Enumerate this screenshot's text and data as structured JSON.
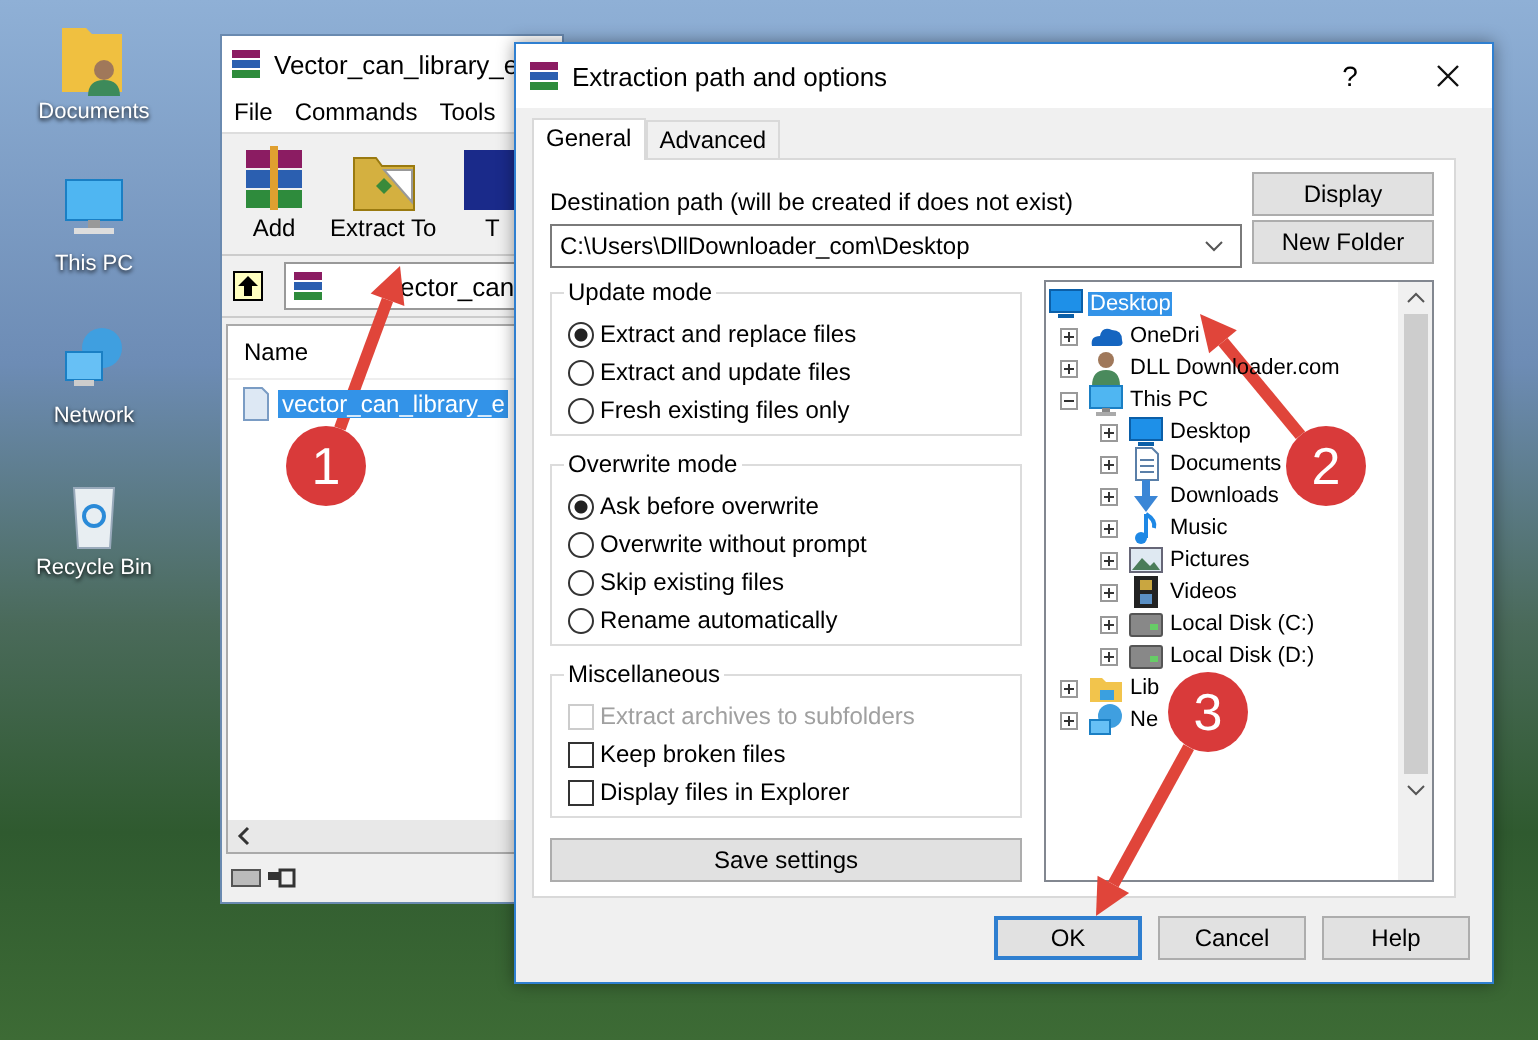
{
  "desktop_icons": [
    {
      "label": "Documents",
      "kind": "documents"
    },
    {
      "label": "This PC",
      "kind": "pc"
    },
    {
      "label": "Network",
      "kind": "network"
    },
    {
      "label": "Recycle Bin",
      "kind": "recycle"
    }
  ],
  "archive_window": {
    "title": "Vector_can_library_e",
    "menu": [
      "File",
      "Commands",
      "Tools"
    ],
    "toolbar": [
      {
        "label": "Add",
        "kind": "add"
      },
      {
        "label": "Extract To",
        "kind": "extract"
      },
      {
        "label": "T",
        "kind": "test"
      }
    ],
    "address": "ector_can",
    "list_header": "Name",
    "files": [
      {
        "name": "vector_can_library_e",
        "selected": true
      }
    ]
  },
  "dialog": {
    "title": "Extraction path and options",
    "help": "?",
    "tabs": [
      {
        "label": "General",
        "selected": true
      },
      {
        "label": "Advanced",
        "selected": false
      }
    ],
    "destination_label": "Destination path (will be created if does not exist)",
    "destination_path": "C:\\Users\\DllDownloader_com\\Desktop",
    "side_buttons": [
      "Display",
      "New Folder"
    ],
    "groups": [
      {
        "title": "Update mode",
        "kind": "radio",
        "options": [
          {
            "label": "Extract and replace files",
            "selected": true
          },
          {
            "label": "Extract and update files",
            "selected": false
          },
          {
            "label": "Fresh existing files only",
            "selected": false
          }
        ]
      },
      {
        "title": "Overwrite mode",
        "kind": "radio",
        "options": [
          {
            "label": "Ask before overwrite",
            "selected": true
          },
          {
            "label": "Overwrite without prompt",
            "selected": false
          },
          {
            "label": "Skip existing files",
            "selected": false
          },
          {
            "label": "Rename automatically",
            "selected": false
          }
        ]
      },
      {
        "title": "Miscellaneous",
        "kind": "checkbox",
        "options": [
          {
            "label": "Extract archives to subfolders",
            "checked": false,
            "disabled": true
          },
          {
            "label": "Keep broken files",
            "checked": false,
            "disabled": false
          },
          {
            "label": "Display files in Explorer",
            "checked": false,
            "disabled": false
          }
        ]
      }
    ],
    "save_button": "Save settings",
    "tree": [
      {
        "label": "Desktop",
        "kind": "desktop",
        "selected": true,
        "children": [
          {
            "label": "OneDri",
            "kind": "cloud",
            "expanded": false,
            "selected": false
          },
          {
            "label": "DLL Downloader.com",
            "kind": "user",
            "expanded": false,
            "selected": false
          },
          {
            "label": "This PC",
            "kind": "pc",
            "expanded": true,
            "selected": false,
            "children": [
              {
                "label": "Desktop",
                "kind": "desktop",
                "expanded": false,
                "selected": false
              },
              {
                "label": "Documents",
                "kind": "document",
                "expanded": false,
                "selected": false
              },
              {
                "label": "Downloads",
                "kind": "download",
                "expanded": false,
                "selected": false
              },
              {
                "label": "Music",
                "kind": "music",
                "expanded": false,
                "selected": false
              },
              {
                "label": "Pictures",
                "kind": "picture",
                "expanded": false,
                "selected": false
              },
              {
                "label": "Videos",
                "kind": "video",
                "expanded": false,
                "selected": false
              },
              {
                "label": "Local Disk (C:)",
                "kind": "disk",
                "expanded": false,
                "selected": false
              },
              {
                "label": "Local Disk (D:)",
                "kind": "disk",
                "expanded": false,
                "selected": false
              }
            ]
          },
          {
            "label": "Lib",
            "kind": "folder",
            "expanded": false,
            "selected": false
          },
          {
            "label": "Ne",
            "kind": "network",
            "expanded": false,
            "selected": false
          }
        ]
      }
    ],
    "buttons": [
      {
        "label": "OK",
        "default": true
      },
      {
        "label": "Cancel",
        "default": false
      },
      {
        "label": "Help",
        "default": false
      }
    ]
  },
  "annotations": [
    {
      "number": "1"
    },
    {
      "number": "2"
    },
    {
      "number": "3"
    }
  ]
}
